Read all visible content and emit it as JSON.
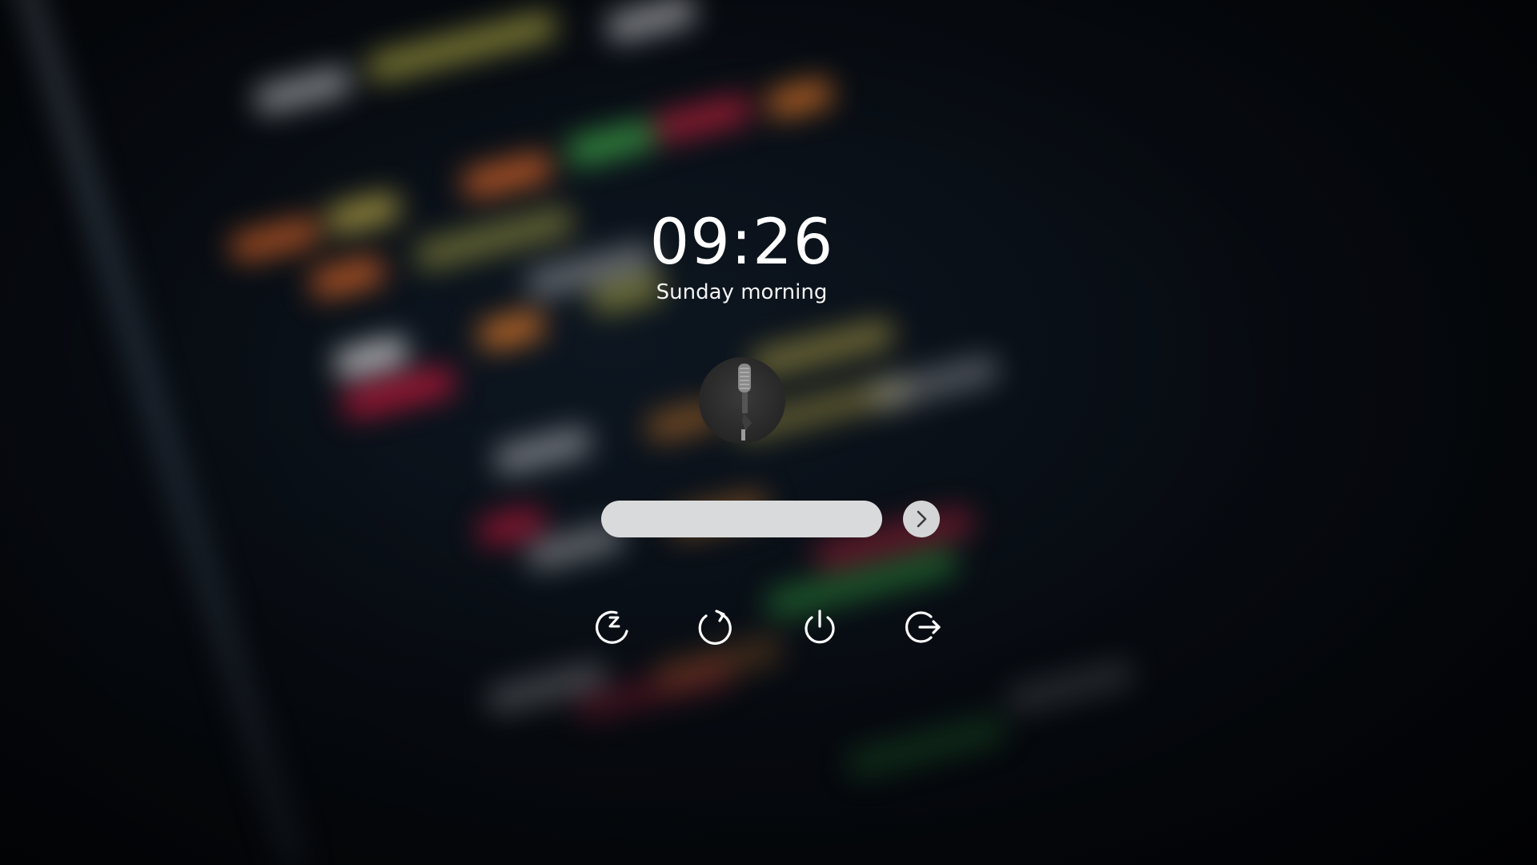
{
  "lockscreen": {
    "time": "09:26",
    "greeting": "Sunday morning",
    "password": {
      "value": "",
      "placeholder": ""
    },
    "submit_icon": "chevron-right-icon",
    "actions": [
      {
        "name": "sleep",
        "icon": "sleep-icon"
      },
      {
        "name": "restart",
        "icon": "restart-icon"
      },
      {
        "name": "shutdown",
        "icon": "power-icon"
      },
      {
        "name": "logout",
        "icon": "logout-icon"
      }
    ]
  },
  "colors": {
    "background": "#05080d",
    "text": "#ffffff",
    "input": "#d9dadb",
    "icon_dark": "#3a3a3a"
  }
}
